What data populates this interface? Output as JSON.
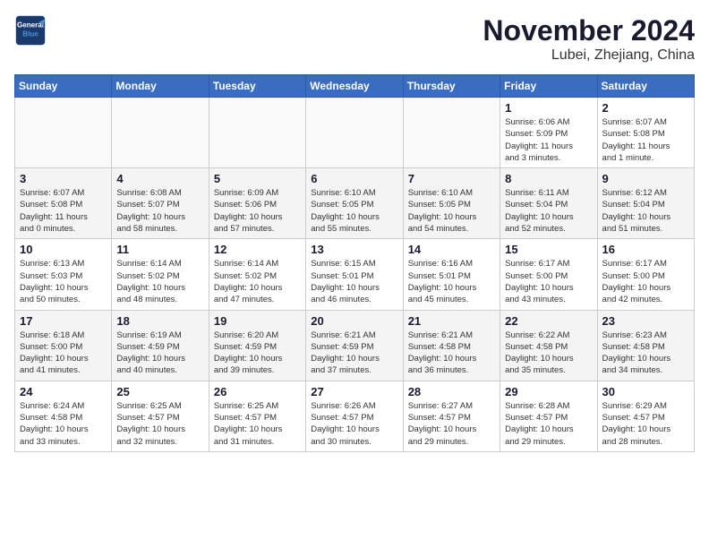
{
  "header": {
    "logo_line1": "General",
    "logo_line2": "Blue",
    "month_title": "November 2024",
    "location": "Lubei, Zhejiang, China"
  },
  "weekdays": [
    "Sunday",
    "Monday",
    "Tuesday",
    "Wednesday",
    "Thursday",
    "Friday",
    "Saturday"
  ],
  "weeks": [
    [
      {
        "day": "",
        "info": ""
      },
      {
        "day": "",
        "info": ""
      },
      {
        "day": "",
        "info": ""
      },
      {
        "day": "",
        "info": ""
      },
      {
        "day": "",
        "info": ""
      },
      {
        "day": "1",
        "info": "Sunrise: 6:06 AM\nSunset: 5:09 PM\nDaylight: 11 hours\nand 3 minutes."
      },
      {
        "day": "2",
        "info": "Sunrise: 6:07 AM\nSunset: 5:08 PM\nDaylight: 11 hours\nand 1 minute."
      }
    ],
    [
      {
        "day": "3",
        "info": "Sunrise: 6:07 AM\nSunset: 5:08 PM\nDaylight: 11 hours\nand 0 minutes."
      },
      {
        "day": "4",
        "info": "Sunrise: 6:08 AM\nSunset: 5:07 PM\nDaylight: 10 hours\nand 58 minutes."
      },
      {
        "day": "5",
        "info": "Sunrise: 6:09 AM\nSunset: 5:06 PM\nDaylight: 10 hours\nand 57 minutes."
      },
      {
        "day": "6",
        "info": "Sunrise: 6:10 AM\nSunset: 5:05 PM\nDaylight: 10 hours\nand 55 minutes."
      },
      {
        "day": "7",
        "info": "Sunrise: 6:10 AM\nSunset: 5:05 PM\nDaylight: 10 hours\nand 54 minutes."
      },
      {
        "day": "8",
        "info": "Sunrise: 6:11 AM\nSunset: 5:04 PM\nDaylight: 10 hours\nand 52 minutes."
      },
      {
        "day": "9",
        "info": "Sunrise: 6:12 AM\nSunset: 5:04 PM\nDaylight: 10 hours\nand 51 minutes."
      }
    ],
    [
      {
        "day": "10",
        "info": "Sunrise: 6:13 AM\nSunset: 5:03 PM\nDaylight: 10 hours\nand 50 minutes."
      },
      {
        "day": "11",
        "info": "Sunrise: 6:14 AM\nSunset: 5:02 PM\nDaylight: 10 hours\nand 48 minutes."
      },
      {
        "day": "12",
        "info": "Sunrise: 6:14 AM\nSunset: 5:02 PM\nDaylight: 10 hours\nand 47 minutes."
      },
      {
        "day": "13",
        "info": "Sunrise: 6:15 AM\nSunset: 5:01 PM\nDaylight: 10 hours\nand 46 minutes."
      },
      {
        "day": "14",
        "info": "Sunrise: 6:16 AM\nSunset: 5:01 PM\nDaylight: 10 hours\nand 45 minutes."
      },
      {
        "day": "15",
        "info": "Sunrise: 6:17 AM\nSunset: 5:00 PM\nDaylight: 10 hours\nand 43 minutes."
      },
      {
        "day": "16",
        "info": "Sunrise: 6:17 AM\nSunset: 5:00 PM\nDaylight: 10 hours\nand 42 minutes."
      }
    ],
    [
      {
        "day": "17",
        "info": "Sunrise: 6:18 AM\nSunset: 5:00 PM\nDaylight: 10 hours\nand 41 minutes."
      },
      {
        "day": "18",
        "info": "Sunrise: 6:19 AM\nSunset: 4:59 PM\nDaylight: 10 hours\nand 40 minutes."
      },
      {
        "day": "19",
        "info": "Sunrise: 6:20 AM\nSunset: 4:59 PM\nDaylight: 10 hours\nand 39 minutes."
      },
      {
        "day": "20",
        "info": "Sunrise: 6:21 AM\nSunset: 4:59 PM\nDaylight: 10 hours\nand 37 minutes."
      },
      {
        "day": "21",
        "info": "Sunrise: 6:21 AM\nSunset: 4:58 PM\nDaylight: 10 hours\nand 36 minutes."
      },
      {
        "day": "22",
        "info": "Sunrise: 6:22 AM\nSunset: 4:58 PM\nDaylight: 10 hours\nand 35 minutes."
      },
      {
        "day": "23",
        "info": "Sunrise: 6:23 AM\nSunset: 4:58 PM\nDaylight: 10 hours\nand 34 minutes."
      }
    ],
    [
      {
        "day": "24",
        "info": "Sunrise: 6:24 AM\nSunset: 4:58 PM\nDaylight: 10 hours\nand 33 minutes."
      },
      {
        "day": "25",
        "info": "Sunrise: 6:25 AM\nSunset: 4:57 PM\nDaylight: 10 hours\nand 32 minutes."
      },
      {
        "day": "26",
        "info": "Sunrise: 6:25 AM\nSunset: 4:57 PM\nDaylight: 10 hours\nand 31 minutes."
      },
      {
        "day": "27",
        "info": "Sunrise: 6:26 AM\nSunset: 4:57 PM\nDaylight: 10 hours\nand 30 minutes."
      },
      {
        "day": "28",
        "info": "Sunrise: 6:27 AM\nSunset: 4:57 PM\nDaylight: 10 hours\nand 29 minutes."
      },
      {
        "day": "29",
        "info": "Sunrise: 6:28 AM\nSunset: 4:57 PM\nDaylight: 10 hours\nand 29 minutes."
      },
      {
        "day": "30",
        "info": "Sunrise: 6:29 AM\nSunset: 4:57 PM\nDaylight: 10 hours\nand 28 minutes."
      }
    ]
  ]
}
